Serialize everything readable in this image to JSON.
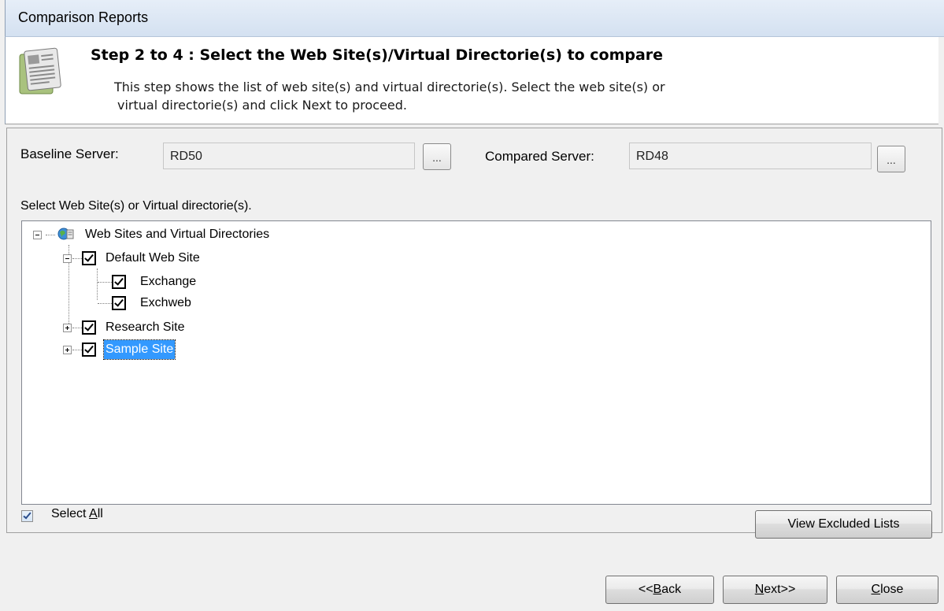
{
  "window": {
    "title": "Comparison Reports"
  },
  "header": {
    "step_title": "Step 2 to 4 : Select the Web Site(s)/Virtual Directorie(s) to compare",
    "description_line1": "This step shows the list of web site(s) and virtual directorie(s). Select the web site(s) or",
    "description_line2": "virtual directorie(s) and click Next to proceed."
  },
  "servers": {
    "baseline_label": "Baseline Server:",
    "baseline_value": "RD50",
    "compared_label": "Compared Server:",
    "compared_value": "RD48",
    "browse_label": "..."
  },
  "tree": {
    "instruction": "Select Web Site(s) or Virtual directorie(s).",
    "root_label": "Web Sites and Virtual Directories",
    "nodes": [
      {
        "label": "Default Web Site",
        "checked": true,
        "expanded": true,
        "children": [
          {
            "label": "Exchange",
            "checked": true
          },
          {
            "label": "Exchweb",
            "checked": true
          }
        ]
      },
      {
        "label": "Research Site",
        "checked": true,
        "expanded": false
      },
      {
        "label": "Sample Site",
        "checked": true,
        "expanded": false,
        "selected": true
      }
    ]
  },
  "footer": {
    "select_all_label_prefix": "Select ",
    "select_all_label_underlined": "A",
    "select_all_label_suffix": "ll",
    "select_all_checked": true,
    "view_excluded_label": "View Excluded Lists"
  },
  "nav": {
    "back_prefix": "<<",
    "back_underlined": "B",
    "back_suffix": "ack",
    "next_underlined": "N",
    "next_suffix": "ext>>",
    "close_underlined": "C",
    "close_suffix": "lose"
  },
  "colors": {
    "selection": "#3399ff",
    "title_bar": "#d4e1f1"
  }
}
